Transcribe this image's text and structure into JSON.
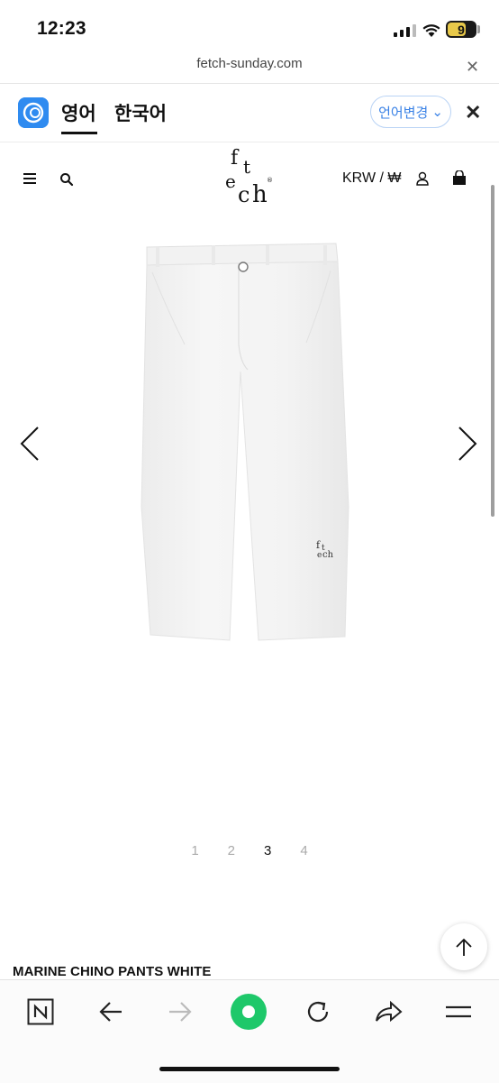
{
  "status_bar": {
    "time": "12:23",
    "battery": "9"
  },
  "browser": {
    "url": "fetch-sunday.com"
  },
  "translate_bar": {
    "tab_english": "영어",
    "tab_korean": "한국어",
    "change_language": "언어변경"
  },
  "header": {
    "logo_text": "fetch",
    "currency": "KRW / ₩"
  },
  "product": {
    "pagination": [
      "1",
      "2",
      "3",
      "4"
    ],
    "active_page": "3",
    "title": "MARINE CHINO PANTS WHITE"
  },
  "icons": {
    "menu": "hamburger-menu-icon",
    "search": "search-icon",
    "account": "user-icon",
    "cart": "shopping-bag-icon",
    "scroll_top": "arrow-up-icon",
    "naver": "naver-n-icon",
    "back": "arrow-left-icon",
    "forward": "arrow-right-icon",
    "green_dot": "green-dot-icon",
    "reload": "reload-icon",
    "share": "share-icon",
    "more": "hamburger-icon"
  },
  "colors": {
    "accent_blue": "#3a82e6",
    "green": "#1ec86a"
  }
}
